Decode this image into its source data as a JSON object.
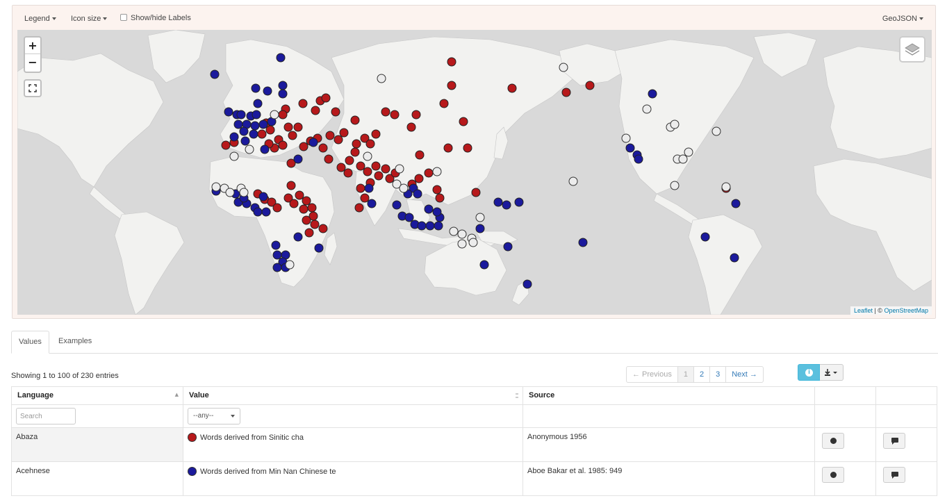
{
  "topbar": {
    "legend_label": "Legend",
    "icon_size_label": "Icon size",
    "labels_toggle_label": "Show/hide Labels",
    "geojson_label": "GeoJSON"
  },
  "map": {
    "zoom_in_label": "+",
    "zoom_out_label": "−",
    "attribution_leaflet": "Leaflet",
    "attribution_separator": " | © ",
    "attribution_osm": "OpenStreetMap",
    "colors": {
      "ocean": "#d9d9d9",
      "land": "#f2f2f0",
      "red_marker": "#b7191b",
      "blue_marker": "#1b1a9c",
      "white_marker": "#ececec"
    }
  },
  "tabs": [
    {
      "label": "Values",
      "active": true
    },
    {
      "label": "Examples",
      "active": false
    }
  ],
  "table_info": "Showing 1 to 100 of 230 entries",
  "pagination": {
    "previous": "← Previous",
    "pages": [
      "1",
      "2",
      "3"
    ],
    "next": "Next →"
  },
  "table": {
    "columns": [
      "Language",
      "Value",
      "Source"
    ],
    "search_placeholder": "Search",
    "value_filter": "--any--",
    "rows": [
      {
        "language": "Abaza",
        "value_color": "#b7191b",
        "value": "Words derived from Sinitic cha",
        "source": "Anonymous 1956"
      },
      {
        "language": "Acehnese",
        "value_color": "#1b1a9c",
        "value": "Words derived from Min Nan Chinese te",
        "source": "Aboe Bakar et al. 1985: 949"
      }
    ]
  }
}
